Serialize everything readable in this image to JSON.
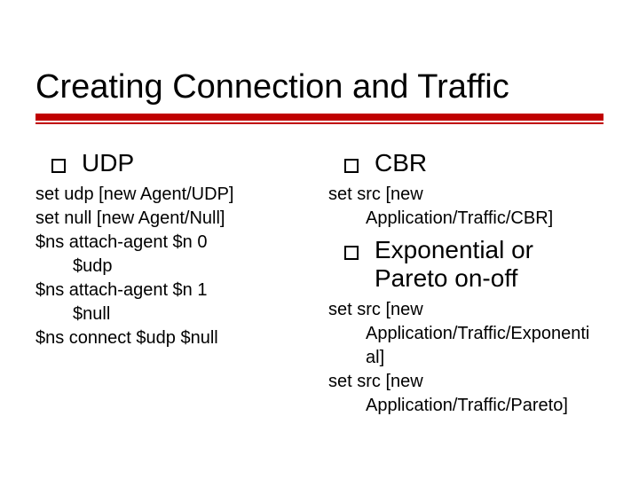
{
  "title": "Creating Connection and Traffic",
  "left": {
    "heading": "UDP",
    "code": {
      "l1": "set udp [new Agent/UDP]",
      "l2": "set null [new Agent/Null]",
      "l3": "$ns attach-agent $n 0",
      "l3b": "$udp",
      "l4": "$ns attach-agent $n 1",
      "l4b": "$null",
      "l5": "$ns connect $udp $null"
    }
  },
  "right": {
    "heading1": "CBR",
    "code1": {
      "l1": "set src [new",
      "l1b": "Application/Traffic/CBR]"
    },
    "heading2": "Exponential or Pareto on-off",
    "code2": {
      "l1": "set src [new",
      "l1b": "Application/Traffic/Exponenti",
      "l1c": "al]",
      "l2": "set src [new",
      "l2b": "Application/Traffic/Pareto]"
    }
  }
}
